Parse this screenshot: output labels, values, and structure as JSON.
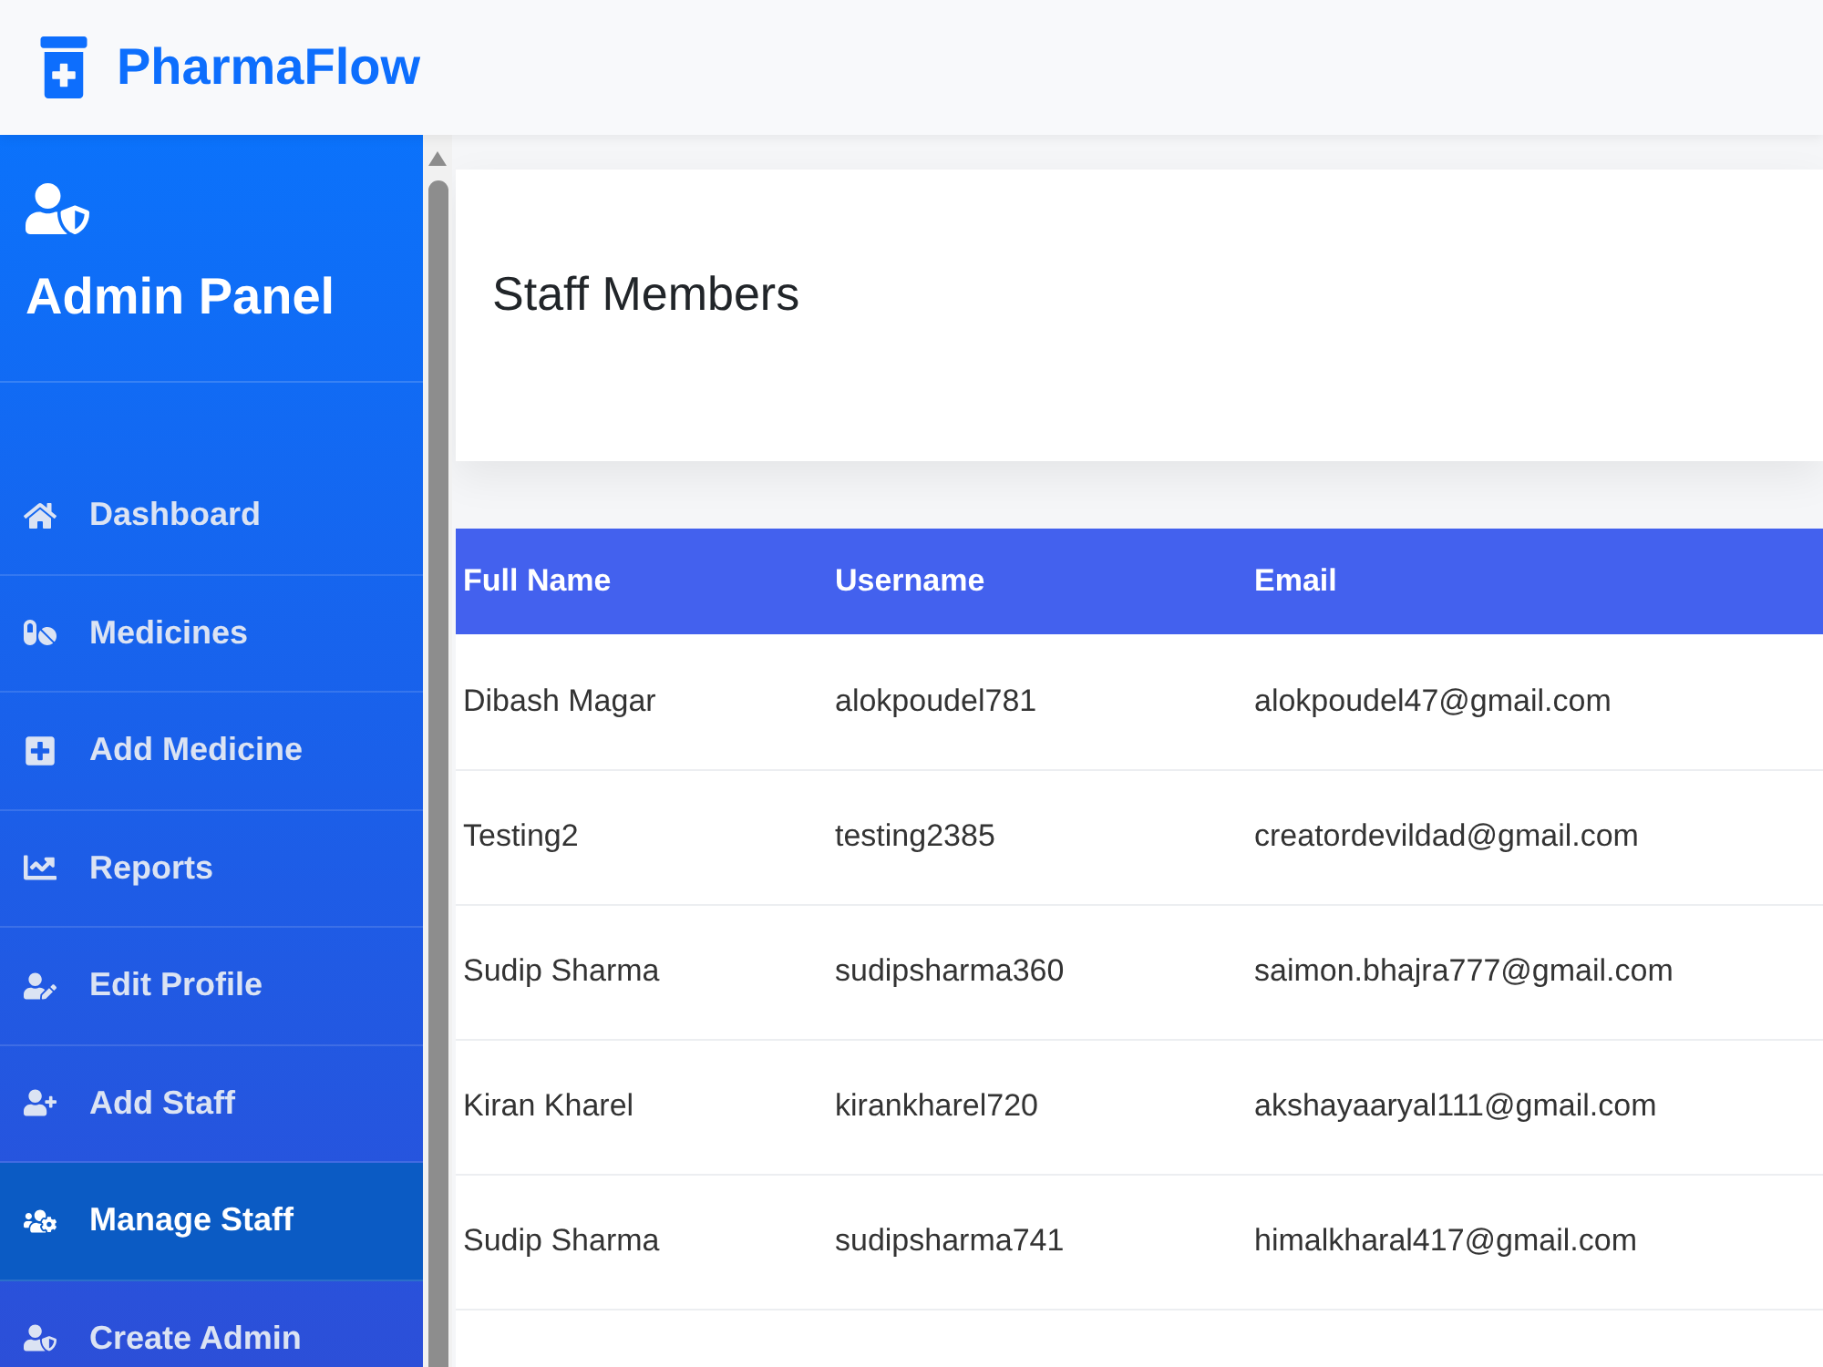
{
  "app": {
    "name": "PharmaFlow"
  },
  "sidebar": {
    "title": "Admin Panel",
    "items": [
      {
        "label": "Dashboard",
        "selected": false
      },
      {
        "label": "Medicines",
        "selected": false
      },
      {
        "label": "Add Medicine",
        "selected": false
      },
      {
        "label": "Reports",
        "selected": false
      },
      {
        "label": "Edit Profile",
        "selected": false
      },
      {
        "label": "Add Staff",
        "selected": false
      },
      {
        "label": "Manage Staff",
        "selected": true
      },
      {
        "label": "Create Admin",
        "selected": false
      }
    ]
  },
  "page": {
    "title": "Staff Members"
  },
  "table": {
    "columns": [
      "Full Name",
      "Username",
      "Email"
    ],
    "rows": [
      [
        "Dibash Magar",
        "alokpoudel781",
        "alokpoudel47@gmail.com"
      ],
      [
        "Testing2",
        "testing2385",
        "creatordevildad@gmail.com"
      ],
      [
        "Sudip Sharma",
        "sudipsharma360",
        "saimon.bhajra777@gmail.com"
      ],
      [
        "Kiran Kharel",
        "kirankharel720",
        "akshayaaryal111@gmail.com"
      ],
      [
        "Sudip Sharma",
        "sudipsharma741",
        "himalkharal417@gmail.com"
      ]
    ]
  }
}
